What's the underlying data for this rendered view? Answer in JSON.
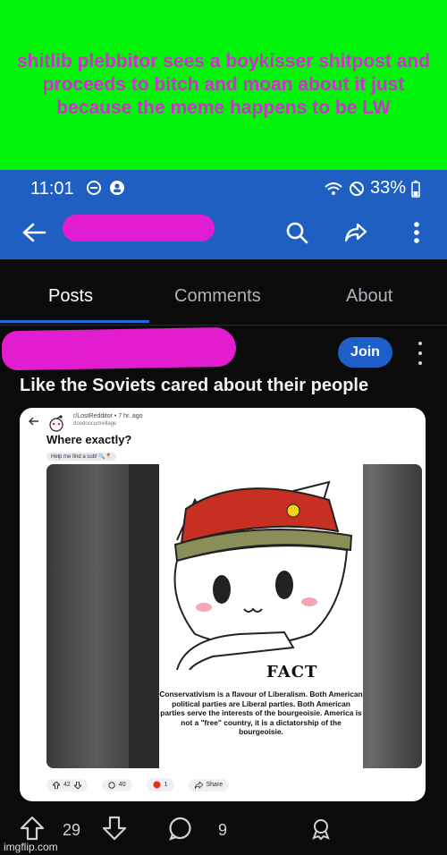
{
  "caption": {
    "text": "shitlib plebbitor sees a boykisser shitpost and proceeds to bitch and moan about it just because the meme happens to be LW"
  },
  "status_bar": {
    "time": "11:01",
    "battery": "33%"
  },
  "tabs": [
    {
      "label": "Posts",
      "active": true
    },
    {
      "label": "Comments",
      "active": false
    },
    {
      "label": "About",
      "active": false
    }
  ],
  "post": {
    "join_label": "Join",
    "title": "Like the Soviets cared about their people",
    "upvotes": "29",
    "comments": "9"
  },
  "embedded": {
    "subreddit_line": "r/LostRedditor • 7 hr. ago",
    "username": "doodoocumvillage",
    "title": "Where exactly?",
    "flair": "Help me find a sub! 🔍📍",
    "meme_caption": "FACT",
    "meme_text": "Conservativism is a flavour of Liberalism. Both American political parties are Liberal parties. Both American parties serve the interests of the bourgeoisie. America is not a \"free\" country, it is a dictatorship of the bourgeoisie.",
    "votes": "42",
    "comments": "40",
    "awards": "1",
    "share_label": "Share"
  },
  "watermark": "imgflip.com",
  "colors": {
    "caption_bg": "#00f50b",
    "caption_text": "#d42dd0",
    "appbar": "#1f5fc1",
    "accent": "#1e6ad8",
    "redaction": "#e21ccf"
  }
}
